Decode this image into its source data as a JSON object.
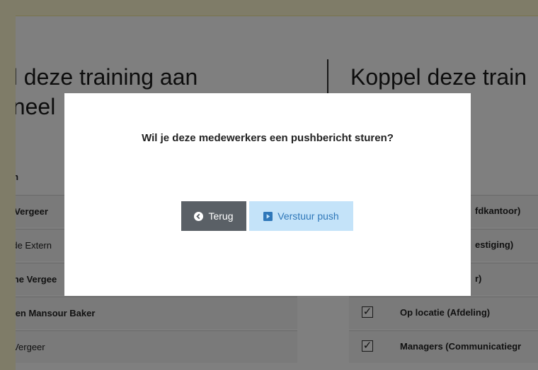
{
  "left_panel": {
    "heading_line1": "el deze training aan",
    "heading_line2": "oneel",
    "column_header": "aam",
    "rows": [
      {
        "label": "ter Vergeer",
        "bold": true
      },
      {
        "label": "es de Extern",
        "bold": false
      },
      {
        "label": "ienne Vergee",
        "bold": true
      },
      {
        "label": "sseen Mansour Baker",
        "bold": true
      },
      {
        "label": "ne Vergeer",
        "bold": false
      }
    ]
  },
  "right_panel": {
    "heading": "Koppel deze train",
    "rows": [
      {
        "label": "fdkantoor)",
        "checked": false
      },
      {
        "label": "estiging)",
        "checked": false
      },
      {
        "label": "r)",
        "checked": false
      },
      {
        "label": "Op locatie (Afdeling)",
        "checked": true
      },
      {
        "label": "Managers (Communicatiegr",
        "checked": true
      }
    ]
  },
  "modal": {
    "message": "Wil je deze medewerkers een pushbericht sturen?",
    "back_label": "Terug",
    "push_label": "Verstuur push",
    "checkmark": "✓"
  },
  "colors": {
    "back_button": "#5a6066",
    "push_button_bg": "#c4e3f9",
    "push_button_text": "#2e77b9",
    "top_strip": "#fef8d0"
  },
  "icons": {
    "back": "chevron-left-circle-icon",
    "push": "play-square-icon"
  }
}
